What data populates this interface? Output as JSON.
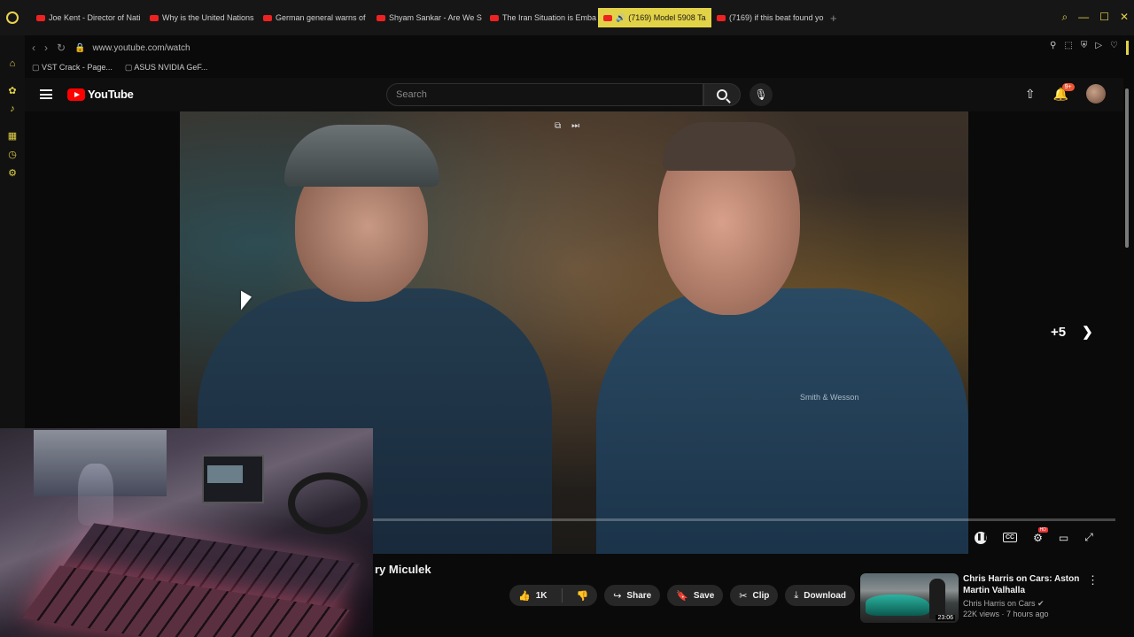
{
  "browser": {
    "tabs": [
      {
        "label": "Joe Kent - Director of Nati",
        "active": false,
        "audio": false
      },
      {
        "label": "Why is the United Nations",
        "active": false,
        "audio": false
      },
      {
        "label": "German general warns of",
        "active": false,
        "audio": false
      },
      {
        "label": "Shyam Sankar - Are We S",
        "active": false,
        "audio": false
      },
      {
        "label": "The Iran Situation is Emba",
        "active": false,
        "audio": false
      },
      {
        "label": "(7169) Model 5908 Ta",
        "active": true,
        "audio": true
      },
      {
        "label": "(7169) if this beat found yo",
        "active": false,
        "audio": false
      }
    ],
    "new_tab_glyph": "+",
    "url": "www.youtube.com/watch",
    "bookmarks": [
      "VST Crack - Page...",
      "ASUS NVIDIA GeF..."
    ],
    "accent_color": "#e2d247"
  },
  "youtube": {
    "logo_text": "YouTube",
    "search_placeholder": "Search",
    "notifications_badge": "9+",
    "player": {
      "endscreen_count": "+5",
      "emblem_text": "Smith & Wesson",
      "cc_label": "CC",
      "hd_label": "HD"
    },
    "video": {
      "title_fragment": "ry Miculek",
      "likes": "1K",
      "share_label": "Share",
      "save_label": "Save",
      "clip_label": "Clip",
      "download_label": "Download"
    },
    "recommendation": {
      "title": "Chris Harris on Cars: Aston Martin Valhalla",
      "channel": "Chris Harris on Cars",
      "meta": "22K views · 7 hours ago",
      "duration": "23:06"
    }
  }
}
